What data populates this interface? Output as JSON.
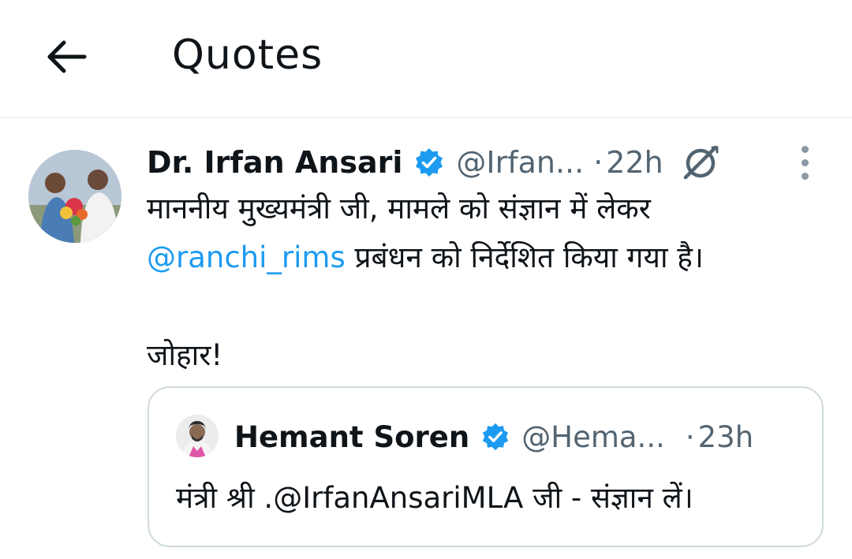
{
  "header": {
    "title": "Quotes",
    "back_icon": "arrow-left-icon"
  },
  "tweet": {
    "author_name": "Dr. Irfan Ansari",
    "handle": "@Irfan...",
    "separator": "·",
    "time": "22h",
    "text_line1": "माननीय मुख्यमंत्री जी, मामले को संज्ञान में लेकर",
    "mention": "@ranchi_rims",
    "text_line2_rest": " प्रबंधन को निर्देशित किया गया है।",
    "text_line3": "जोहार!",
    "icons": [
      "verified-badge-icon",
      "grok-icon",
      "more-options-icon"
    ]
  },
  "quoted_tweet": {
    "author_name": "Hemant Soren",
    "handle": "@Hema...",
    "separator": "·",
    "time": "23h",
    "text": "मंत्री श्री .@IrfanAnsariMLA जी - संज्ञान लें।"
  },
  "colors": {
    "accent": "#1d9bf0",
    "text": "#0f1419",
    "secondary": "#536471",
    "border": "#cfd9de",
    "verified": "#1d9bf0"
  }
}
